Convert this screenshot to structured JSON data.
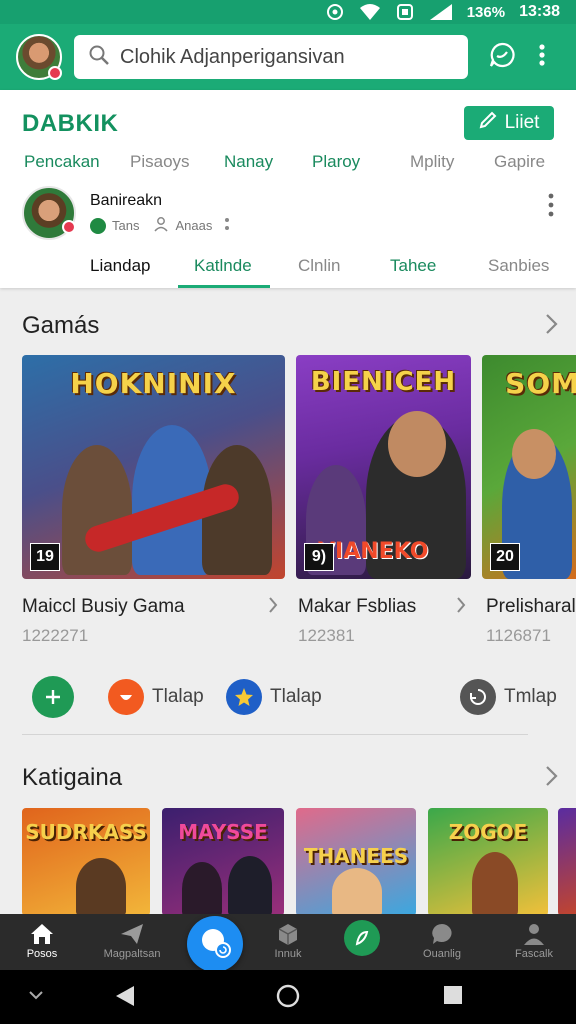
{
  "status_bar": {
    "battery": "136%",
    "time": "13:38"
  },
  "app_bar": {
    "search_placeholder": "Clohik Adjanperigansivan"
  },
  "header": {
    "brand": "DABKIK",
    "edit_label": "Liiet",
    "top_tabs": [
      {
        "label": "Pencakan",
        "color": "#1a8a5e"
      },
      {
        "label": "Pisaoys",
        "color": "#888888"
      },
      {
        "label": "Nanay",
        "color": "#1a8a5e"
      },
      {
        "label": "Plaroy",
        "color": "#1a8a5e"
      },
      {
        "label": "Mplity",
        "color": "#888888"
      },
      {
        "label": "Gapire",
        "color": "#888888"
      }
    ],
    "profile": {
      "name": "Banireakn",
      "meta1": "Tans",
      "meta2": "Anaas"
    },
    "sub_tabs": [
      {
        "label": "Liandap",
        "color": "#111111"
      },
      {
        "label": "Katlnde",
        "color": "#1a8a5e"
      },
      {
        "label": "Clnlin",
        "color": "#888888"
      },
      {
        "label": "Tahee",
        "color": "#1a8a5e"
      },
      {
        "label": "Sanbies",
        "color": "#888888"
      }
    ]
  },
  "games_section": {
    "title": "Gamás",
    "cards": [
      {
        "logo": "HOKNINIX",
        "rating": "19",
        "title": "Maiccl Busiy Gama",
        "count": "1222271",
        "palette": [
          "#2d6fa8",
          "#c2452e"
        ]
      },
      {
        "logo": "BIENICEH",
        "rating": "9)",
        "title": "Makar Fsblias",
        "count": "122381",
        "palette": [
          "#6a2ca0",
          "#2a1a3e"
        ]
      },
      {
        "logo": "SOM",
        "rating": "20",
        "title": "Prelisharal",
        "count": "1126871",
        "palette": [
          "#3d8a2e",
          "#d86a1c"
        ]
      }
    ]
  },
  "quick_links": [
    {
      "label": "",
      "icon": "chat-plus-icon",
      "color": "#1f9a55"
    },
    {
      "label": "Tlalap",
      "icon": "smile-icon",
      "color": "#f25a20"
    },
    {
      "label": "Tlalap",
      "icon": "star-icon",
      "color": "#1f5fc7"
    },
    {
      "label": "Tmlap",
      "icon": "recycle-icon",
      "color": "#555555"
    }
  ],
  "category_section": {
    "title": "Katigaina",
    "tiles": [
      {
        "logo": "SUDRKASS",
        "palette": [
          "#e0641c",
          "#f2b63a"
        ]
      },
      {
        "logo": "MAYSSE",
        "palette": [
          "#3b1f6e",
          "#9a2f7a"
        ]
      },
      {
        "logo": "THANEES",
        "palette": [
          "#e06a8a",
          "#3aa8e0"
        ]
      },
      {
        "logo": "ZOGOE",
        "palette": [
          "#3aa84a",
          "#f2c03a"
        ]
      }
    ]
  },
  "bottom_nav": [
    {
      "label": "Posos",
      "icon": "home-icon"
    },
    {
      "label": "Magpaltsan",
      "icon": "send-icon"
    },
    {
      "label": "",
      "icon": "search-fab-icon"
    },
    {
      "label": "Innuk",
      "icon": "box-icon"
    },
    {
      "label": "",
      "icon": "leaf-icon"
    },
    {
      "label": "Ouanlig",
      "icon": "chat-bubble-icon"
    },
    {
      "label": "Fascalk",
      "icon": "person-icon"
    }
  ]
}
